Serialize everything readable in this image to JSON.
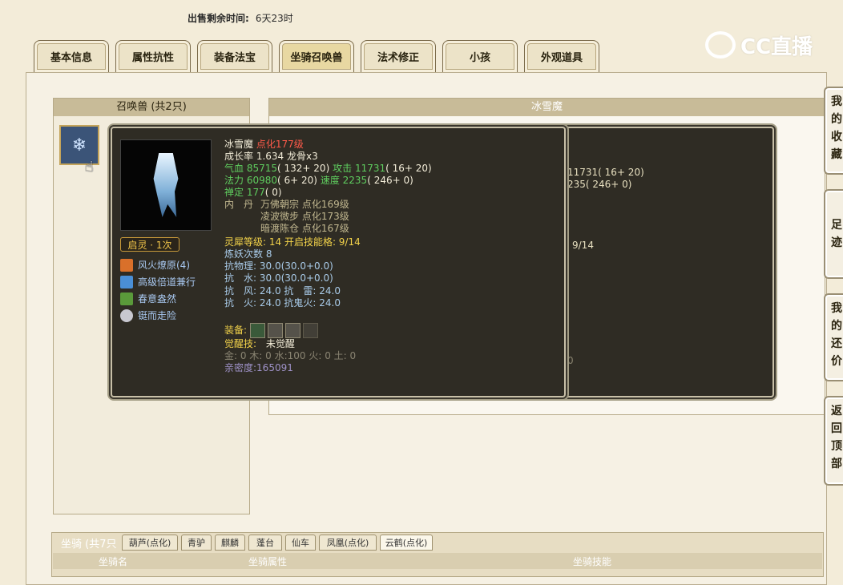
{
  "header": {
    "sell_time_label": "出售剩余时间:",
    "sell_time_value": "6天23时"
  },
  "logo": {
    "text": "CC直播",
    "icon": "cc-logo-icon"
  },
  "tabs": [
    {
      "label": "基本信息"
    },
    {
      "label": "属性抗性"
    },
    {
      "label": "装备法宝"
    },
    {
      "label": "坐骑召唤兽",
      "active": true
    },
    {
      "label": "法术修正"
    },
    {
      "label": "小孩"
    },
    {
      "label": "外观道具"
    }
  ],
  "pet_panel": {
    "title": "召唤兽 (共2只)"
  },
  "detail_panel": {
    "title": "冰雪魔"
  },
  "tooltip_back": {
    "lines": [
      "11731( 16+ 20)",
      "235( 246+ 0)",
      "9/14",
      "0"
    ]
  },
  "tooltip": {
    "qiling": "启灵 · 1次",
    "skills": [
      {
        "name": "风火燎原(4)",
        "icon": "fire-skill-icon"
      },
      {
        "name": "高级倍道兼行",
        "icon": "wind-skill-icon"
      },
      {
        "name": "春意盎然",
        "icon": "spring-skill-icon"
      },
      {
        "name": "铤而走险",
        "icon": "risk-skill-icon"
      }
    ],
    "name": "冰雪魔",
    "refine": "点化177级",
    "growth": "成长率 1.634 龙骨x3",
    "hp_label": "气血",
    "hp_val": "85715",
    "hp_detail": "( 132+ 20)",
    "atk_label": "攻击",
    "atk_val": "11731",
    "atk_detail": "( 16+ 20)",
    "mp_label": "法力",
    "mp_val": "60980",
    "mp_detail": "( 6+ 20)",
    "spd_label": "速度",
    "spd_val": "2235",
    "spd_detail": "( 246+ 0)",
    "focus_label": "禅定",
    "focus_val": "177",
    "focus_detail": "( 0)",
    "neidan_label": "内　丹",
    "neidan": [
      "万佛朝宗 点化169级",
      "凌波微步 点化173级",
      "暗渡陈仓 点化167级"
    ],
    "lingxi": "灵犀等级: 14 开启技能格: 9/14",
    "lianyao": "炼妖次数 8",
    "resist_phys": "抗物理: 30.0(30.0+0.0)",
    "resist_water": "抗　水: 30.0(30.0+0.0)",
    "resist_wind_thunder": "抗　风: 24.0 抗　雷: 24.0",
    "resist_fire_ghost": "抗　火: 24.0 抗鬼火: 24.0",
    "equip_label": "装备:",
    "awaken_label": "觉醒技:",
    "awaken_value": "未觉醒",
    "elements": "金: 0 木: 0 水:100 火: 0 土: 0",
    "intimacy": "亲密度:165091"
  },
  "side_buttons": [
    {
      "label": "我的收藏"
    },
    {
      "label": "足迹"
    },
    {
      "label": "我的还价"
    },
    {
      "label": "返回顶部"
    }
  ],
  "mount": {
    "title": "坐骑 (共7只",
    "tabs": [
      "葫芦(点化)",
      "青驴",
      "麒麟",
      "蓬台",
      "仙车",
      "凤凰(点化)",
      "云鹤(点化)"
    ],
    "columns": [
      "坐骑名",
      "坐骑属性",
      "坐骑技能"
    ]
  }
}
